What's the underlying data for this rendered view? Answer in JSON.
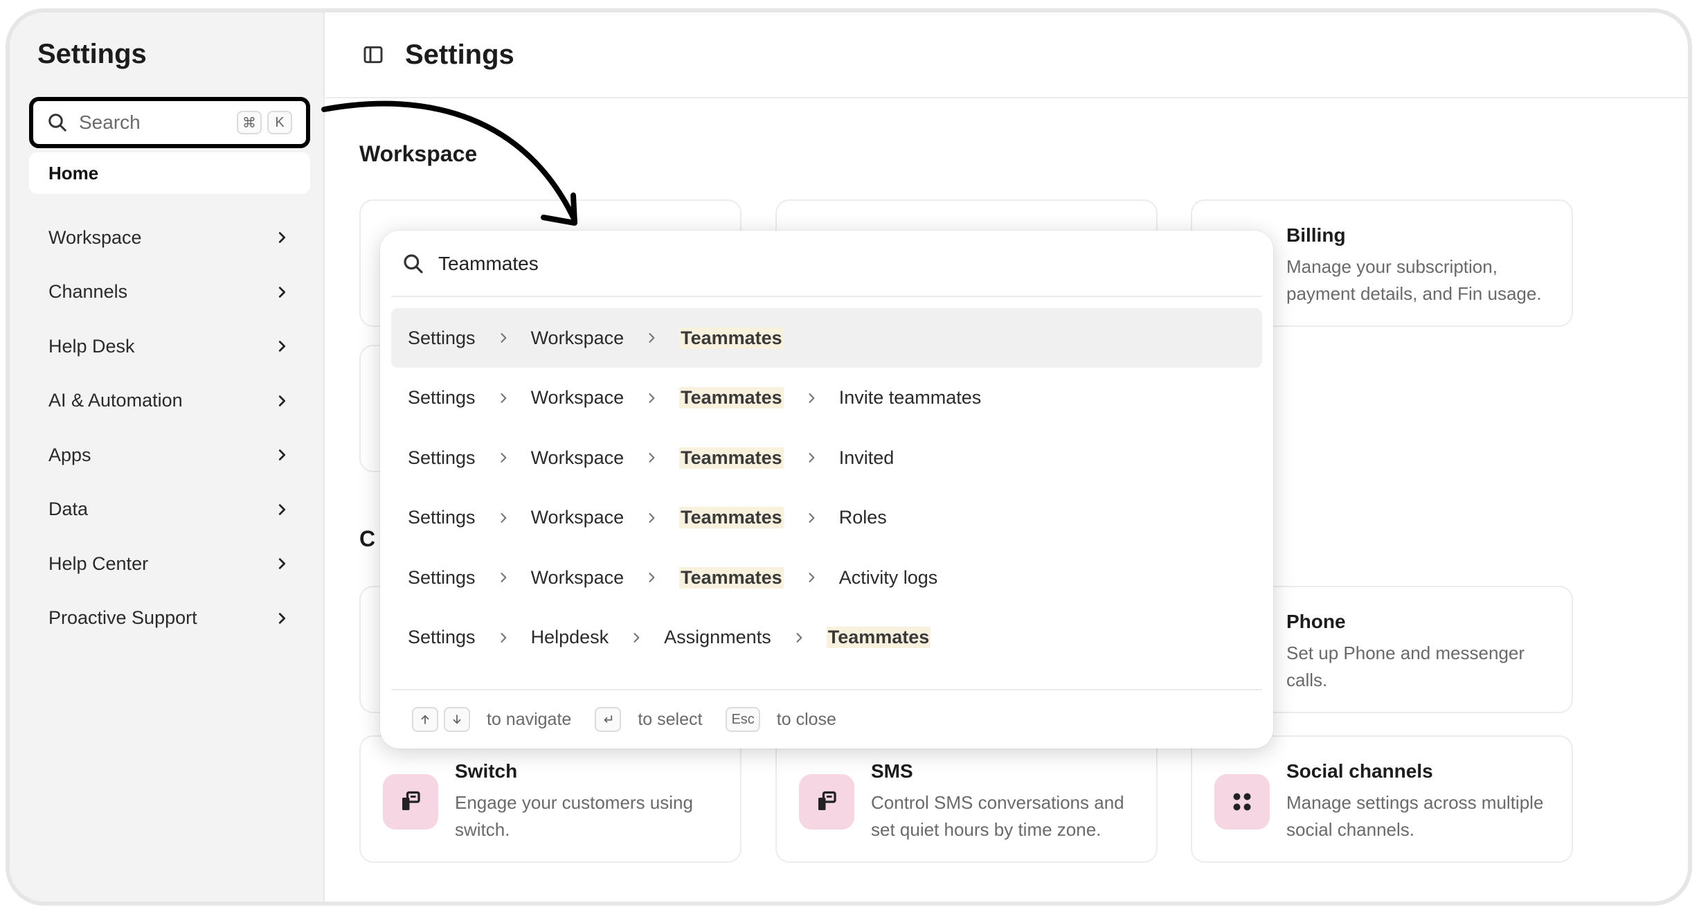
{
  "sidebar": {
    "title": "Settings",
    "search": {
      "placeholder": "Search",
      "shortcut_key1": "⌘",
      "shortcut_key2": "K"
    },
    "home_label": "Home",
    "items": [
      {
        "label": "Workspace"
      },
      {
        "label": "Channels"
      },
      {
        "label": "Help Desk"
      },
      {
        "label": "AI & Automation"
      },
      {
        "label": "Apps"
      },
      {
        "label": "Data"
      },
      {
        "label": "Help Center"
      },
      {
        "label": "Proactive Support"
      }
    ]
  },
  "header": {
    "title": "Settings"
  },
  "main": {
    "section1_title": "Workspace",
    "section2_title": "C",
    "cards": {
      "billing": {
        "title": "Billing",
        "desc": "Manage your subscription, payment details, and Fin usage."
      },
      "phone": {
        "title": "Phone",
        "desc": "Set up Phone and messenger calls."
      },
      "switch": {
        "title": "Switch",
        "desc": "Engage your customers using switch."
      },
      "sms": {
        "title": "SMS",
        "desc": "Control SMS conversations and set quiet hours by time zone."
      },
      "social": {
        "title": "Social channels",
        "desc": "Manage settings across multiple social channels."
      }
    }
  },
  "command_palette": {
    "query": "Teammates",
    "results": [
      {
        "crumbs": [
          "Settings",
          "Workspace",
          "Teammates"
        ],
        "highlight": 2
      },
      {
        "crumbs": [
          "Settings",
          "Workspace",
          "Teammates",
          "Invite teammates"
        ],
        "highlight": 2
      },
      {
        "crumbs": [
          "Settings",
          "Workspace",
          "Teammates",
          "Invited"
        ],
        "highlight": 2
      },
      {
        "crumbs": [
          "Settings",
          "Workspace",
          "Teammates",
          "Roles"
        ],
        "highlight": 2
      },
      {
        "crumbs": [
          "Settings",
          "Workspace",
          "Teammates",
          "Activity logs"
        ],
        "highlight": 2
      },
      {
        "crumbs": [
          "Settings",
          "Helpdesk",
          "Assignments",
          "Teammates"
        ],
        "highlight": 3
      }
    ],
    "footer": {
      "navigate_label": "to navigate",
      "select_label": "to select",
      "esc_key": "Esc",
      "close_label": "to close"
    }
  },
  "colors": {
    "accent_pink": "#f5d6e2",
    "highlight": "#f7f1de",
    "annotation": "#000000"
  }
}
